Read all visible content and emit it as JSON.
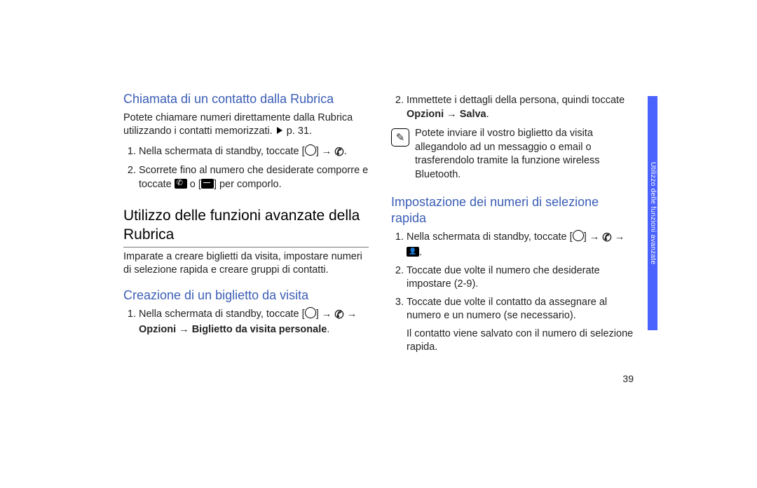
{
  "left": {
    "heading_blue_1": "Chiamata di un contatto dalla Rubrica",
    "para_1a": "Potete chiamare numeri direttamente dalla Rubrica utilizzando i contatti memorizzati. ",
    "para_1b": " p. 31.",
    "step1_a": "Nella schermata di standby, toccate [",
    "step1_b": "] → ",
    "step1_c": ".",
    "step2_a": "Scorrete fino al numero che desiderate comporre e toccate ",
    "step2_b": " o [",
    "step2_c": "] per comporlo.",
    "heading_main": "Utilizzo delle funzioni avanzate della Rubrica",
    "para_main": "Imparate a creare biglietti da visita, impostare numeri di selezione rapida e creare gruppi di contatti.",
    "heading_blue_2": "Creazione di un biglietto da visita",
    "bv_step1_a": "Nella schermata di standby, toccate [",
    "bv_step1_b": "] → ",
    "bv_step1_c": " → ",
    "bv_step1_d": "Opzioni → Biglietto da visita personale",
    "bv_step1_e": "."
  },
  "right": {
    "detail_step2_a": "Immettete i dettagli della persona, quindi toccate ",
    "detail_step2_b": "Opzioni → Salva",
    "detail_step2_c": ".",
    "note": "Potete inviare il vostro biglietto da visita allegandolo ad un messaggio o email o trasferendolo tramite la funzione wireless Bluetooth.",
    "heading_blue": "Impostazione dei numeri di selezione rapida",
    "r_step1_a": "Nella schermata di standby, toccate [",
    "r_step1_b": "] → ",
    "r_step1_c": " → ",
    "r_step1_d": ".",
    "r_step2": "Toccate due volte il numero che desiderate impostare (2-9).",
    "r_step3": "Toccate due volte il contatto da assegnare al numero e un numero (se necessario).",
    "r_after": "Il contatto viene salvato con il numero di selezione rapida."
  },
  "pagenum": "39",
  "sidetab": "Utilizzo delle funzioni avanzate"
}
